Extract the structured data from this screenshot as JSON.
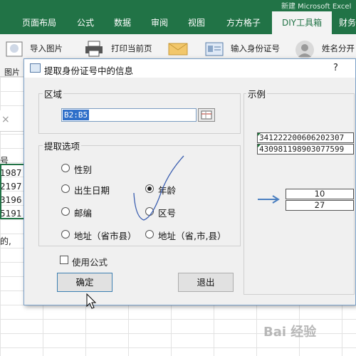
{
  "excel": {
    "title": "新建 Microsoft Excel",
    "tabs": [
      {
        "label": "页面布局"
      },
      {
        "label": "公式"
      },
      {
        "label": "数据"
      },
      {
        "label": "审阅"
      },
      {
        "label": "视图"
      },
      {
        "label": "方方格子"
      },
      {
        "label": "DIY工具箱"
      },
      {
        "label": "财务"
      }
    ],
    "active_tab": "DIY工具箱",
    "ribbon": {
      "import_image": "导入图片",
      "print_current_page": "打印当前页",
      "input_id_number": "输入身份证号",
      "name_split": "姓名分开",
      "left_label_1": "图片",
      "left_label_2": "阅览"
    },
    "sheet": {
      "header_fragment": "号",
      "cell_fragments": [
        "1987",
        "2197",
        "3196",
        "5191"
      ],
      "text_fragment": "的,",
      "close_x": "×"
    }
  },
  "dialog": {
    "title": "提取身份证号中的信息",
    "help": "?",
    "range_group_label": "区域",
    "range_value": "B2:B5",
    "options_group_label": "提取选项",
    "options": [
      {
        "label": "性别",
        "checked": false
      },
      {
        "label": "出生日期",
        "checked": false
      },
      {
        "label": "年龄",
        "checked": true
      },
      {
        "label": "邮编",
        "checked": false
      },
      {
        "label": "区号",
        "checked": false
      },
      {
        "label": "地址（省市县）",
        "checked": false
      },
      {
        "label": "地址（省,市,县）",
        "checked": false
      }
    ],
    "use_formula_label": "使用公式",
    "use_formula_checked": false,
    "ok_button": "确定",
    "exit_button": "退出",
    "example_group_label": "示例",
    "example_ids": [
      "341222200606202307",
      "430981198903077599"
    ],
    "example_results": [
      "10",
      "27"
    ]
  },
  "watermark": "Bai 经验",
  "colors": {
    "excel_green": "#217346",
    "dialog_bg": "#f0f0f0",
    "selection_blue": "#2f6fc9",
    "arrow_blue": "#4a7fc0"
  }
}
